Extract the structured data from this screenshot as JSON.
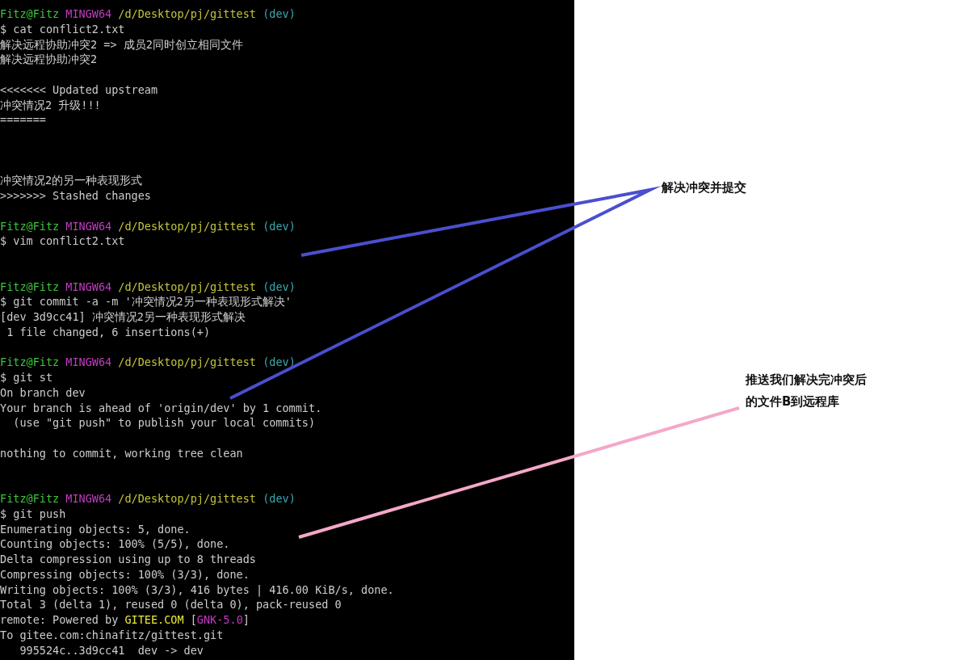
{
  "terminal": {
    "lines": [
      {
        "kind": "colored",
        "parts": [
          {
            "text": "Fitz@Fitz ",
            "color": "#3cc43c"
          },
          {
            "text": "MINGW64 ",
            "color": "#c23bc2"
          },
          {
            "text": "/d/Desktop/pj/gittest ",
            "color": "#c4c43a"
          },
          {
            "text": "(dev)",
            "color": "#3aa9b0"
          }
        ]
      },
      {
        "kind": "text",
        "text": "$ cat conflict2.txt"
      },
      {
        "kind": "text",
        "text": "解决远程协助冲突2 => 成员2同时创立相同文件"
      },
      {
        "kind": "text",
        "text": "解决远程协助冲突2"
      },
      {
        "kind": "blank"
      },
      {
        "kind": "text",
        "text": "<<<<<<< Updated upstream"
      },
      {
        "kind": "text",
        "text": "冲突情况2 升级!!!"
      },
      {
        "kind": "text",
        "text": "======="
      },
      {
        "kind": "blank"
      },
      {
        "kind": "blank"
      },
      {
        "kind": "blank"
      },
      {
        "kind": "text",
        "text": "冲突情况2的另一种表现形式"
      },
      {
        "kind": "text",
        "text": ">>>>>>> Stashed changes"
      },
      {
        "kind": "blank"
      },
      {
        "kind": "colored",
        "parts": [
          {
            "text": "Fitz@Fitz ",
            "color": "#3cc43c"
          },
          {
            "text": "MINGW64 ",
            "color": "#c23bc2"
          },
          {
            "text": "/d/Desktop/pj/gittest ",
            "color": "#c4c43a"
          },
          {
            "text": "(dev)",
            "color": "#3aa9b0"
          }
        ]
      },
      {
        "kind": "text",
        "text": "$ vim conflict2.txt"
      },
      {
        "kind": "blank"
      },
      {
        "kind": "blank"
      },
      {
        "kind": "colored",
        "parts": [
          {
            "text": "Fitz@Fitz ",
            "color": "#3cc43c"
          },
          {
            "text": "MINGW64 ",
            "color": "#c23bc2"
          },
          {
            "text": "/d/Desktop/pj/gittest ",
            "color": "#c4c43a"
          },
          {
            "text": "(dev)",
            "color": "#3aa9b0"
          }
        ]
      },
      {
        "kind": "text",
        "text": "$ git commit -a -m '冲突情况2另一种表现形式解决'"
      },
      {
        "kind": "text",
        "text": "[dev 3d9cc41] 冲突情况2另一种表现形式解决"
      },
      {
        "kind": "text",
        "text": " 1 file changed, 6 insertions(+)"
      },
      {
        "kind": "blank"
      },
      {
        "kind": "colored",
        "parts": [
          {
            "text": "Fitz@Fitz ",
            "color": "#3cc43c"
          },
          {
            "text": "MINGW64 ",
            "color": "#c23bc2"
          },
          {
            "text": "/d/Desktop/pj/gittest ",
            "color": "#c4c43a"
          },
          {
            "text": "(dev)",
            "color": "#3aa9b0"
          }
        ]
      },
      {
        "kind": "text",
        "text": "$ git st"
      },
      {
        "kind": "text",
        "text": "On branch dev"
      },
      {
        "kind": "text",
        "text": "Your branch is ahead of 'origin/dev' by 1 commit."
      },
      {
        "kind": "text",
        "text": "  (use \"git push\" to publish your local commits)"
      },
      {
        "kind": "blank"
      },
      {
        "kind": "text",
        "text": "nothing to commit, working tree clean"
      },
      {
        "kind": "blank"
      },
      {
        "kind": "blank"
      },
      {
        "kind": "colored",
        "parts": [
          {
            "text": "Fitz@Fitz ",
            "color": "#3cc43c"
          },
          {
            "text": "MINGW64 ",
            "color": "#c23bc2"
          },
          {
            "text": "/d/Desktop/pj/gittest ",
            "color": "#c4c43a"
          },
          {
            "text": "(dev)",
            "color": "#3aa9b0"
          }
        ]
      },
      {
        "kind": "text",
        "text": "$ git push"
      },
      {
        "kind": "text",
        "text": "Enumerating objects: 5, done."
      },
      {
        "kind": "text",
        "text": "Counting objects: 100% (5/5), done."
      },
      {
        "kind": "text",
        "text": "Delta compression using up to 8 threads"
      },
      {
        "kind": "text",
        "text": "Compressing objects: 100% (3/3), done."
      },
      {
        "kind": "text",
        "text": "Writing objects: 100% (3/3), 416 bytes | 416.00 KiB/s, done."
      },
      {
        "kind": "text",
        "text": "Total 3 (delta 1), reused 0 (delta 0), pack-reused 0"
      },
      {
        "kind": "colored",
        "parts": [
          {
            "text": "remote: Powered by ",
            "color": "#cccccc"
          },
          {
            "text": "GITEE.COM ",
            "color": "#e8e83a"
          },
          {
            "text": "[",
            "color": "#cccccc"
          },
          {
            "text": "GNK-5.0",
            "color": "#c23bc2"
          },
          {
            "text": "]",
            "color": "#cccccc"
          }
        ]
      },
      {
        "kind": "text",
        "text": "To gitee.com:chinafitz/gittest.git"
      },
      {
        "kind": "text",
        "text": "   995524c..3d9cc41  dev -> dev"
      }
    ]
  },
  "annotations": [
    {
      "lines": [
        "解决冲突并提交"
      ]
    },
    {
      "lines": [
        "推送我们解决完冲突后",
        "的文件B到远程库"
      ]
    }
  ]
}
